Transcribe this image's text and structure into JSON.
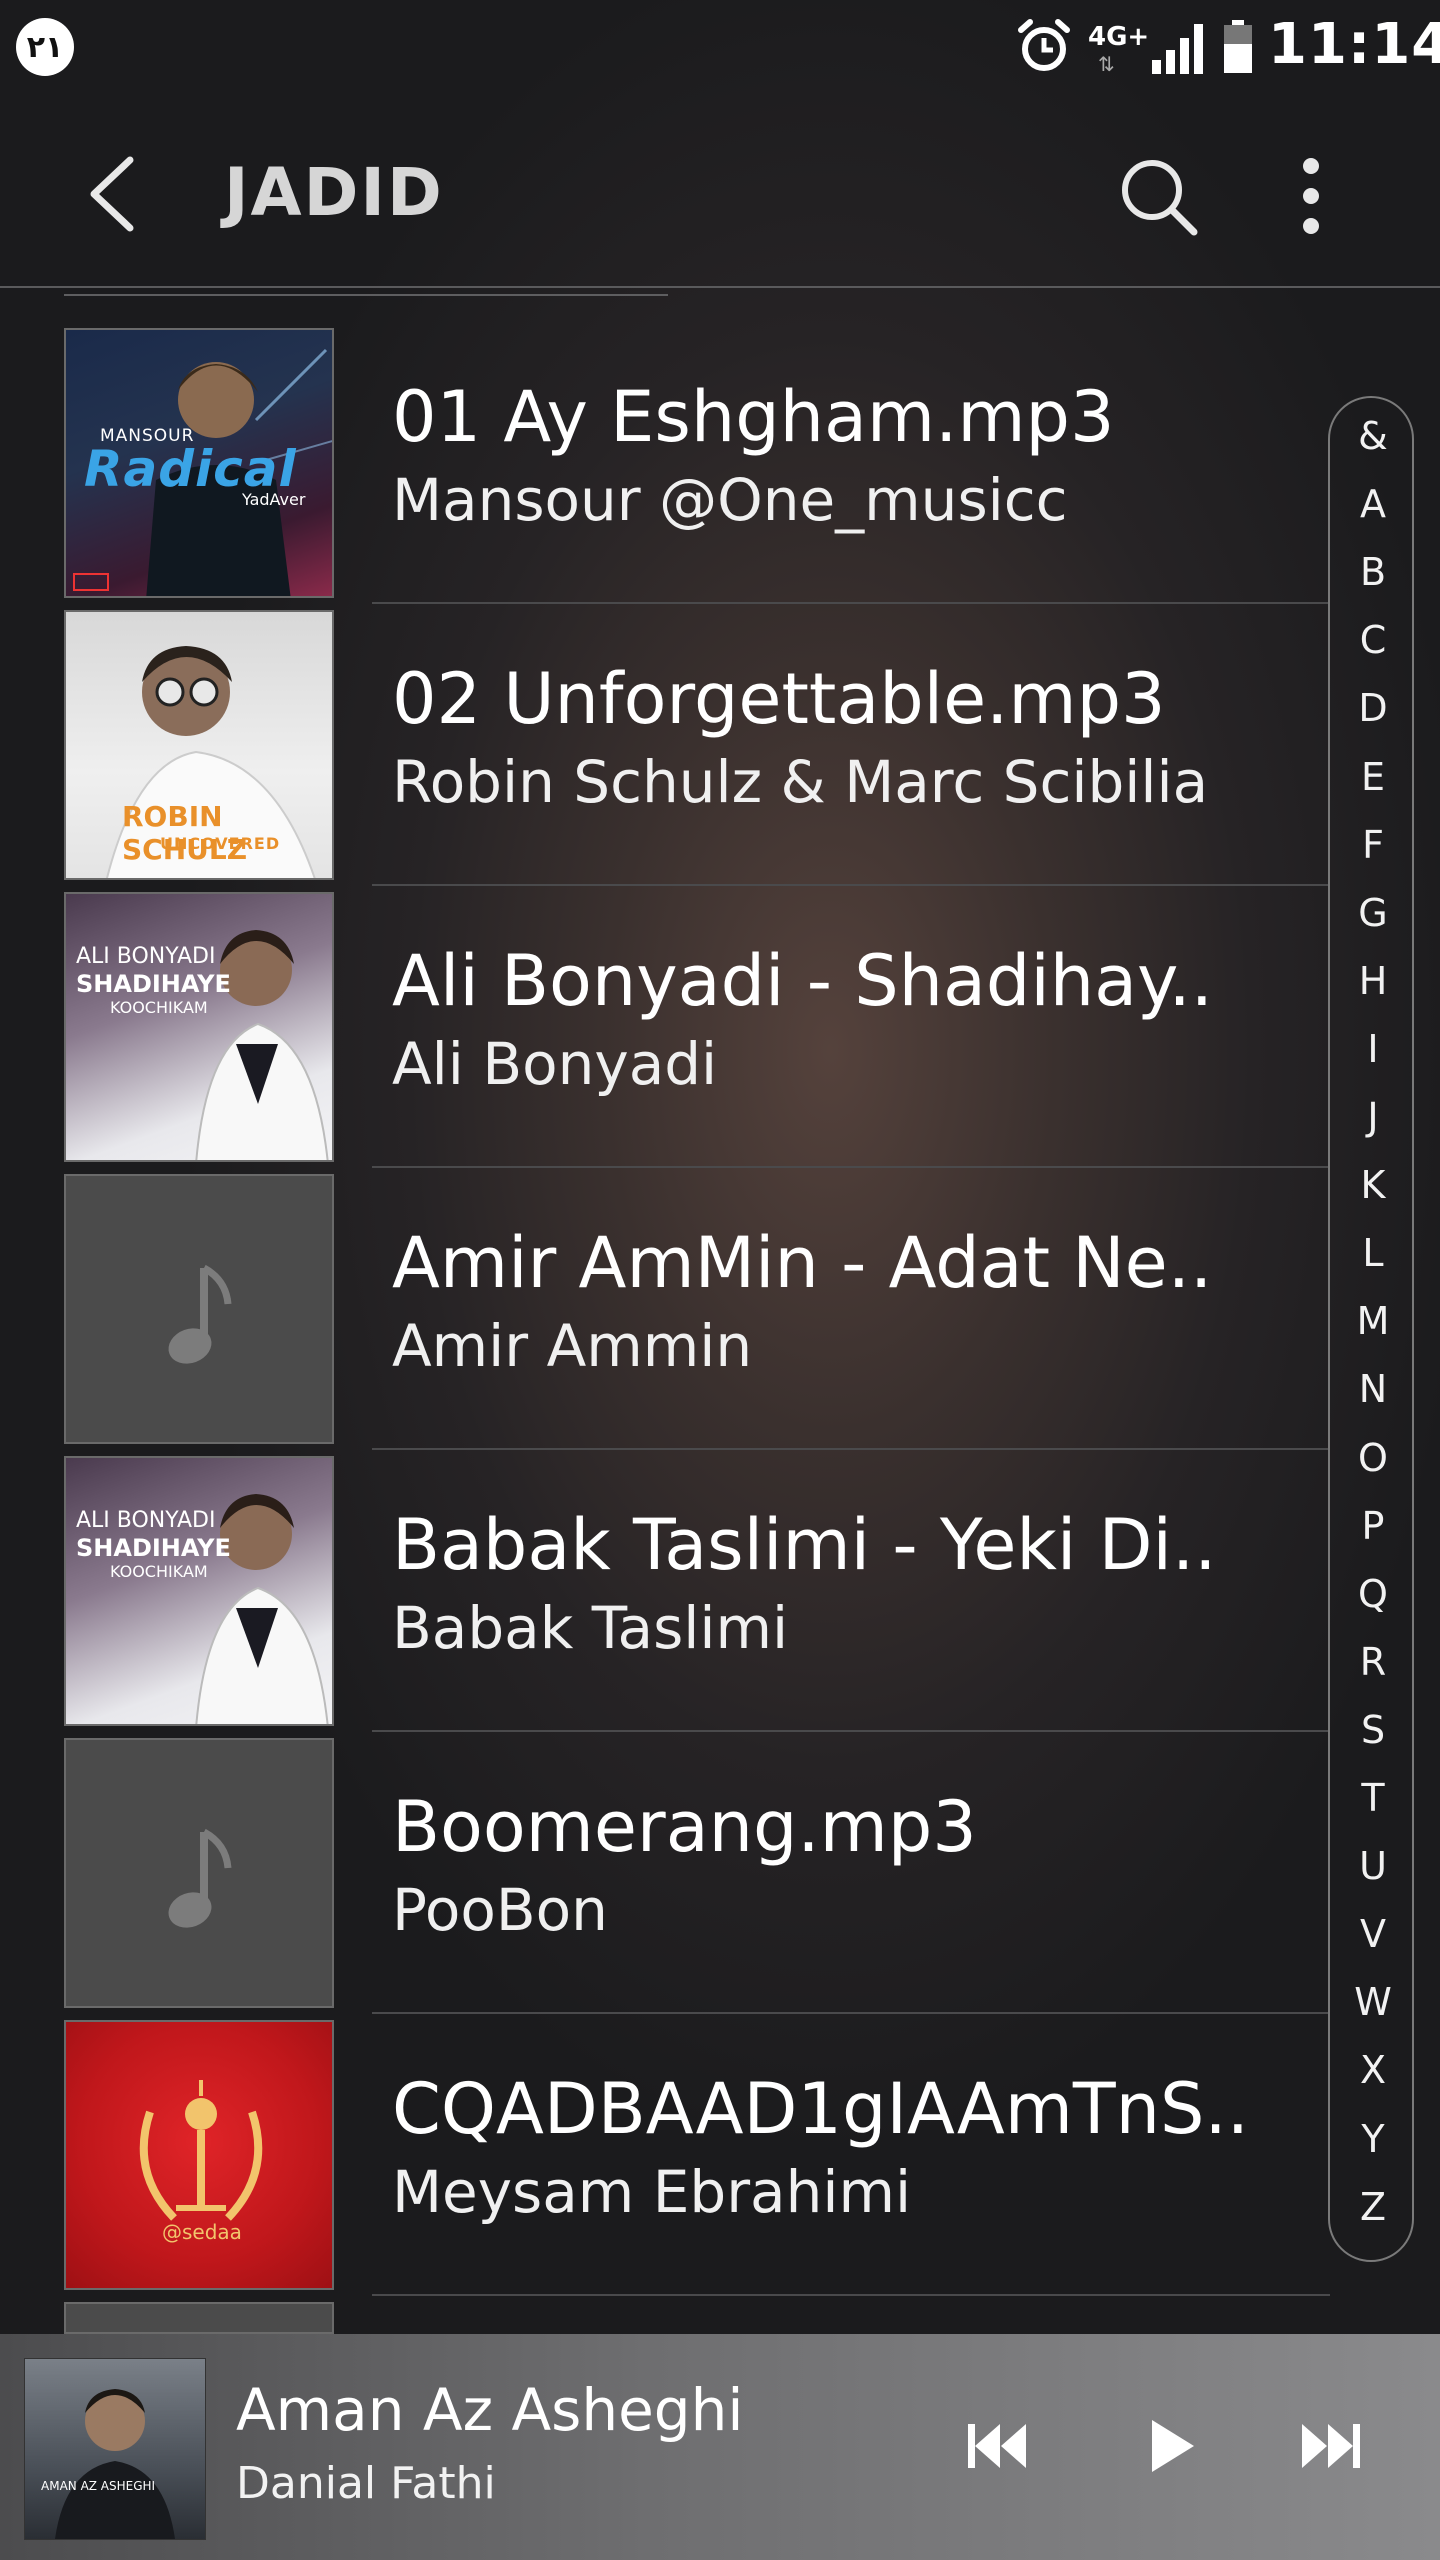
{
  "status_bar": {
    "badge": "۲۱",
    "network": "4G+",
    "network_arrows": "⇅",
    "time": "11:14"
  },
  "app_bar": {
    "title": "JADID"
  },
  "tracks": [
    {
      "title": "01 Ay Eshgham.mp3",
      "artist": "Mansour @One_musicc",
      "art": "radical"
    },
    {
      "title": "02 Unforgettable.mp3",
      "artist": "Robin Schulz & Marc Scibilia",
      "art": "robin"
    },
    {
      "title": "Ali Bonyadi - Shadihay..",
      "artist": "Ali Bonyadi",
      "art": "bonyadi"
    },
    {
      "title": "Amir AmMin - Adat Ne..",
      "artist": "Amir Ammin",
      "art": "note"
    },
    {
      "title": "Babak Taslimi - Yeki Di..",
      "artist": "Babak Taslimi",
      "art": "bonyadi"
    },
    {
      "title": "Boomerang.mp3",
      "artist": "PooBon",
      "art": "note"
    },
    {
      "title": "CQADBAAD1gIAAmTnS..",
      "artist": "Meysam Ebrahimi",
      "art": "sedaa"
    }
  ],
  "album_art_text": {
    "radical_top": "MANSOUR",
    "radical_main": "Radical",
    "radical_sub": "YadAver",
    "robin_name": "ROBIN SCHULZ",
    "robin_sub": "UNCOVERED",
    "bonyadi_1": "ALI BONYADI",
    "bonyadi_2": "SHADIHAYE",
    "bonyadi_3": "KOOCHIKAM",
    "sedaa": "@sedaa",
    "player_art_text": "AMAN AZ ASHEGHI"
  },
  "index_letters": [
    "&",
    "A",
    "B",
    "C",
    "D",
    "E",
    "F",
    "G",
    "H",
    "I",
    "J",
    "K",
    "L",
    "M",
    "N",
    "O",
    "P",
    "Q",
    "R",
    "S",
    "T",
    "U",
    "V",
    "W",
    "X",
    "Y",
    "Z"
  ],
  "now_playing": {
    "title": "Aman Az Asheghi",
    "artist": "Danial Fathi"
  },
  "colors": {
    "sedaa_red": "#c0171b",
    "robin_orange": "#e9902a",
    "radical_blue": "#3aa4e6"
  }
}
